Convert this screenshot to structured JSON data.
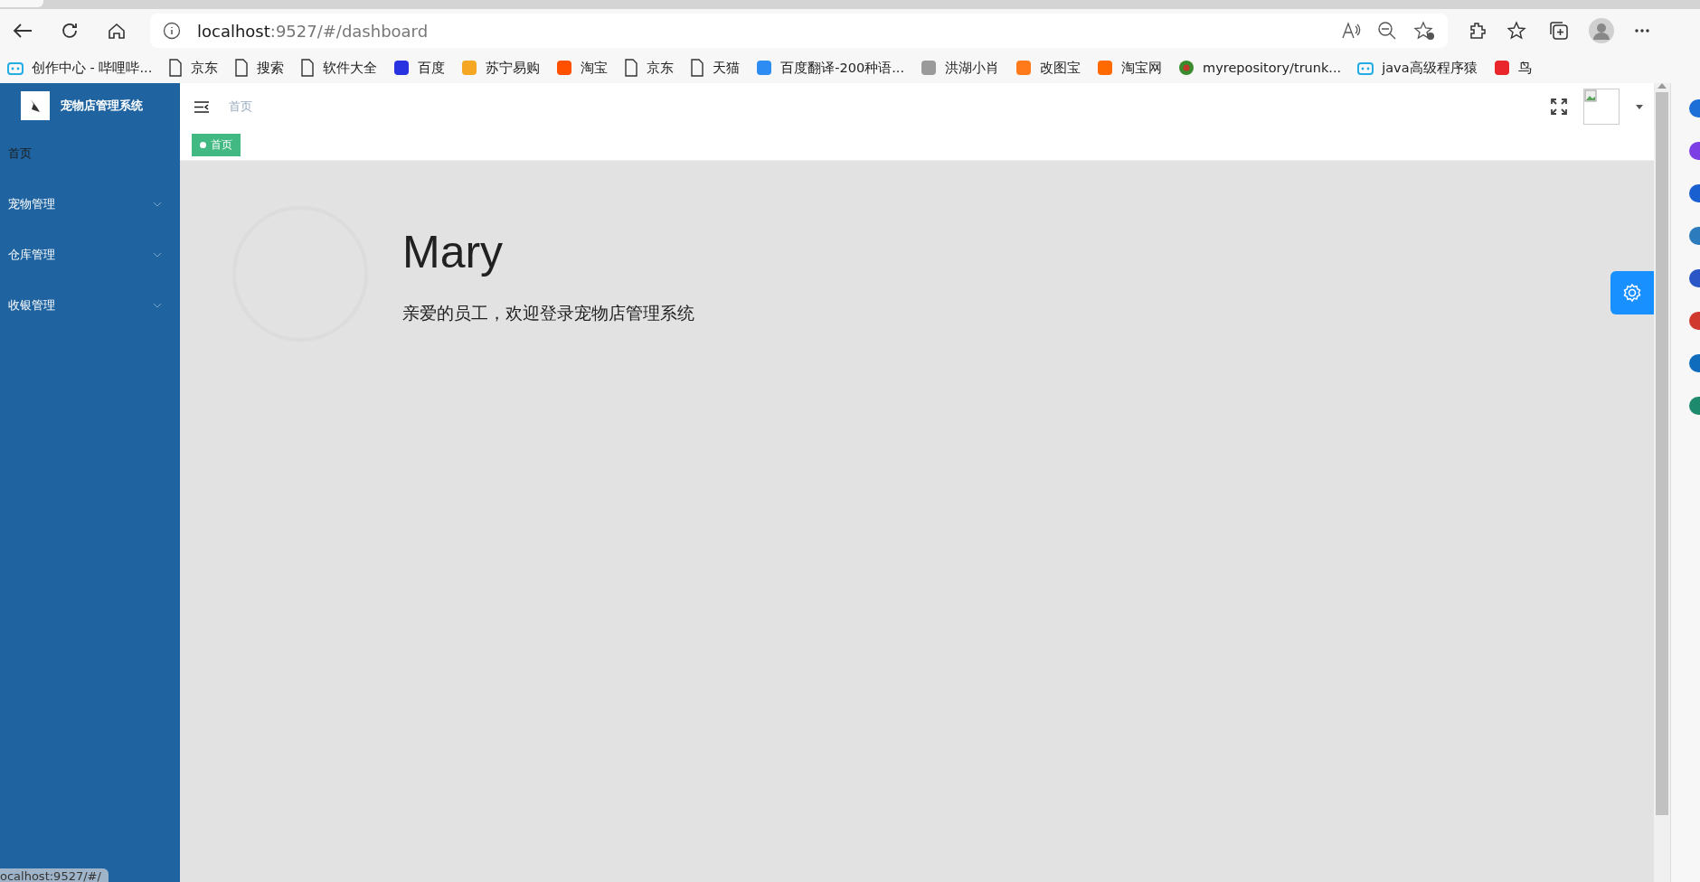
{
  "browser": {
    "url_host": "localhost",
    "url_rest": ":9527/#/dashboard",
    "bookmarks": [
      {
        "label": "创作中心 - 哔哩哔...",
        "kind": "tv",
        "color": "#23ade5"
      },
      {
        "label": "京东",
        "kind": "page"
      },
      {
        "label": "搜索",
        "kind": "page"
      },
      {
        "label": "软件大全",
        "kind": "page"
      },
      {
        "label": "百度",
        "kind": "badge",
        "color": "#2932e1"
      },
      {
        "label": "苏宁易购",
        "kind": "badge",
        "color": "#f5a623"
      },
      {
        "label": "淘宝",
        "kind": "badge",
        "color": "#ff5000"
      },
      {
        "label": "京东",
        "kind": "page"
      },
      {
        "label": "天猫",
        "kind": "page"
      },
      {
        "label": "百度翻译-200种语...",
        "kind": "badge",
        "color": "#2c8cf4"
      },
      {
        "label": "洪湖小肖",
        "kind": "badge",
        "color": "#9a9a9a"
      },
      {
        "label": "改图宝",
        "kind": "badge",
        "color": "#ff7a1a"
      },
      {
        "label": "淘宝网",
        "kind": "badge",
        "color": "#ff6a00"
      },
      {
        "label": "myrepository/trunk...",
        "kind": "round",
        "color": "#3a8a2e"
      },
      {
        "label": "java高级程序猿",
        "kind": "tv",
        "color": "#23ade5"
      },
      {
        "label": "鸟",
        "kind": "badge",
        "color": "#e8262b"
      }
    ],
    "status_text": "ocalhost:9527/#/"
  },
  "app": {
    "title": "宠物店管理系统",
    "menu": [
      {
        "label": "首页",
        "selected": true,
        "expandable": false
      },
      {
        "label": "宠物管理",
        "selected": false,
        "expandable": true
      },
      {
        "label": "仓库管理",
        "selected": false,
        "expandable": true
      },
      {
        "label": "收银管理",
        "selected": false,
        "expandable": true
      }
    ],
    "breadcrumb": "首页",
    "tags": [
      {
        "label": "首页",
        "selected": true
      }
    ],
    "user_name": "Mary",
    "welcome": "亲爱的员工，欢迎登录宠物店管理系统"
  }
}
